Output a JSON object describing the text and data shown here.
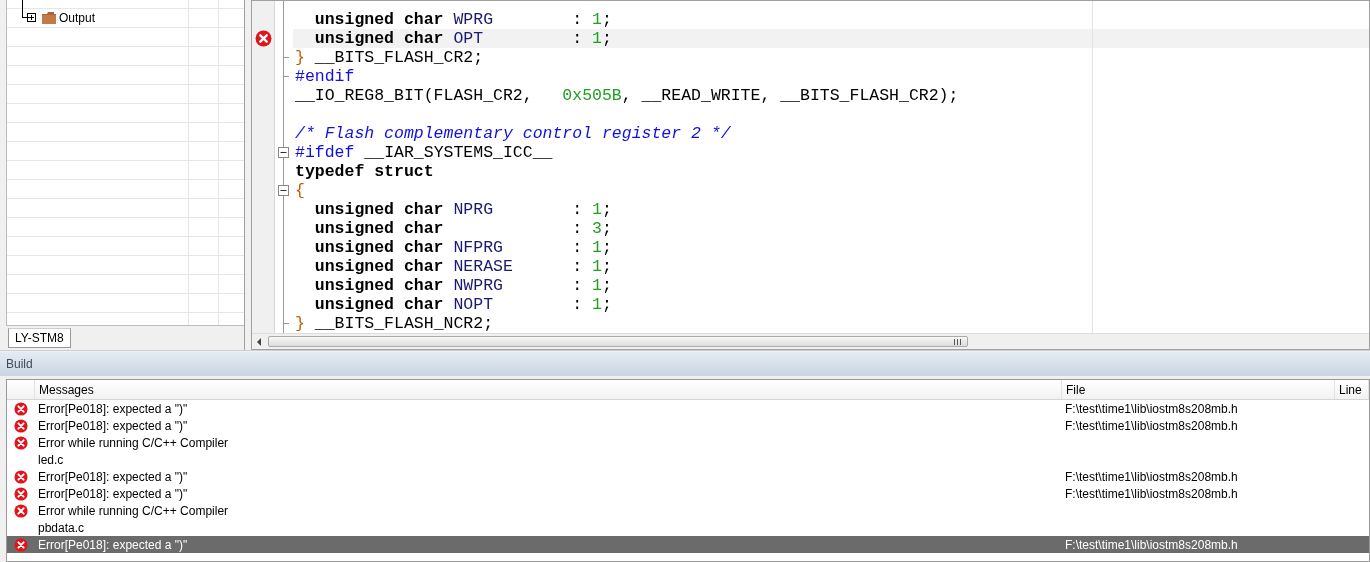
{
  "workspace": {
    "tree": [
      {
        "label": "Output",
        "expanded": false
      }
    ],
    "tabs": [
      {
        "label": "LY-STM8",
        "selected": true
      }
    ]
  },
  "editor": {
    "lines": [
      {
        "kind": "plain",
        "indented": true,
        "error": false,
        "highlighted": false,
        "tokens": [
          {
            "kind": "keyword",
            "text": "unsigned char"
          },
          {
            "kind": "ident",
            "text": " WPRG"
          },
          {
            "kind": "plain",
            "text": "        : "
          },
          {
            "kind": "number",
            "text": "1"
          },
          {
            "kind": "plain",
            "text": ";"
          }
        ]
      },
      {
        "kind": "plain",
        "indented": true,
        "error": true,
        "highlighted": true,
        "tokens": [
          {
            "kind": "keyword",
            "text": "unsigned char"
          },
          {
            "kind": "ident",
            "text": " OPT"
          },
          {
            "kind": "plain",
            "text": "         : "
          },
          {
            "kind": "number",
            "text": "1"
          },
          {
            "kind": "plain",
            "text": ";"
          }
        ]
      },
      {
        "kind": "end",
        "indented": false,
        "error": false,
        "highlighted": false,
        "tokens": [
          {
            "kind": "brace",
            "text": "}"
          },
          {
            "kind": "plain",
            "text": " __BITS_FLASH_CR2;"
          }
        ]
      },
      {
        "kind": "end",
        "indented": false,
        "error": false,
        "highlighted": false,
        "tokens": [
          {
            "kind": "directive",
            "text": "#endif"
          }
        ]
      },
      {
        "kind": "plain",
        "indented": false,
        "error": false,
        "highlighted": false,
        "tokens": [
          {
            "kind": "plain",
            "text": "__IO_REG8_BIT(FLASH_CR2,   "
          },
          {
            "kind": "number",
            "text": "0x505B"
          },
          {
            "kind": "plain",
            "text": ", __READ_WRITE, __BITS_FLASH_CR2);"
          }
        ]
      },
      {
        "kind": "plain"
      },
      {
        "kind": "plain",
        "indented": false,
        "error": false,
        "highlighted": false,
        "tokens": [
          {
            "kind": "comment",
            "text": "/* Flash complementary control register 2 */"
          }
        ]
      },
      {
        "kind": "collapse",
        "indented": false,
        "error": false,
        "highlighted": false,
        "tokens": [
          {
            "kind": "directive",
            "text": "#ifdef"
          },
          {
            "kind": "plain",
            "text": " __IAR_SYSTEMS_ICC__"
          }
        ]
      },
      {
        "kind": "plain",
        "indented": false,
        "error": false,
        "highlighted": false,
        "tokens": [
          {
            "kind": "keyword",
            "text": "typedef struct"
          }
        ]
      },
      {
        "kind": "collapse",
        "indented": false,
        "error": false,
        "highlighted": false,
        "tokens": [
          {
            "kind": "brace",
            "text": "{"
          }
        ]
      },
      {
        "kind": "plain",
        "indented": true,
        "error": false,
        "highlighted": false,
        "tokens": [
          {
            "kind": "keyword",
            "text": "unsigned char"
          },
          {
            "kind": "ident",
            "text": " NPRG"
          },
          {
            "kind": "plain",
            "text": "        : "
          },
          {
            "kind": "number",
            "text": "1"
          },
          {
            "kind": "plain",
            "text": ";"
          }
        ]
      },
      {
        "kind": "plain",
        "indented": true,
        "error": false,
        "highlighted": false,
        "tokens": [
          {
            "kind": "keyword",
            "text": "unsigned char"
          },
          {
            "kind": "plain",
            "text": "             : "
          },
          {
            "kind": "number",
            "text": "3"
          },
          {
            "kind": "plain",
            "text": ";"
          }
        ]
      },
      {
        "kind": "plain",
        "indented": true,
        "error": false,
        "highlighted": false,
        "tokens": [
          {
            "kind": "keyword",
            "text": "unsigned char"
          },
          {
            "kind": "ident",
            "text": " NFPRG"
          },
          {
            "kind": "plain",
            "text": "       : "
          },
          {
            "kind": "number",
            "text": "1"
          },
          {
            "kind": "plain",
            "text": ";"
          }
        ]
      },
      {
        "kind": "plain",
        "indented": true,
        "error": false,
        "highlighted": false,
        "tokens": [
          {
            "kind": "keyword",
            "text": "unsigned char"
          },
          {
            "kind": "ident",
            "text": " NERASE"
          },
          {
            "kind": "plain",
            "text": "      : "
          },
          {
            "kind": "number",
            "text": "1"
          },
          {
            "kind": "plain",
            "text": ";"
          }
        ]
      },
      {
        "kind": "plain",
        "indented": true,
        "error": false,
        "highlighted": false,
        "tokens": [
          {
            "kind": "keyword",
            "text": "unsigned char"
          },
          {
            "kind": "ident",
            "text": " NWPRG"
          },
          {
            "kind": "plain",
            "text": "       : "
          },
          {
            "kind": "number",
            "text": "1"
          },
          {
            "kind": "plain",
            "text": ";"
          }
        ]
      },
      {
        "kind": "plain",
        "indented": true,
        "error": false,
        "highlighted": false,
        "tokens": [
          {
            "kind": "keyword",
            "text": "unsigned char"
          },
          {
            "kind": "ident",
            "text": " NOPT"
          },
          {
            "kind": "plain",
            "text": "        : "
          },
          {
            "kind": "number",
            "text": "1"
          },
          {
            "kind": "plain",
            "text": ";"
          }
        ]
      },
      {
        "kind": "end",
        "indented": false,
        "error": false,
        "highlighted": false,
        "tokens": [
          {
            "kind": "brace",
            "text": "}"
          },
          {
            "kind": "plain",
            "text": " __BITS_FLASH_NCR2;"
          }
        ]
      }
    ]
  },
  "build": {
    "title": "Build",
    "columns": [
      "Messages",
      "File",
      "Line"
    ],
    "rows": [
      {
        "kind": "error",
        "message": "Error[Pe018]: expected a \")\"",
        "file": "F:\\test\\time1\\lib\\iostm8s208mb.h",
        "selected": false
      },
      {
        "kind": "error",
        "message": "Error[Pe018]: expected a \")\"",
        "file": "F:\\test\\time1\\lib\\iostm8s208mb.h",
        "selected": false
      },
      {
        "kind": "error",
        "message": "Error while running C/C++ Compiler",
        "selected": false
      },
      {
        "kind": "plain",
        "message": "led.c",
        "selected": false
      },
      {
        "kind": "error",
        "message": "Error[Pe018]: expected a \")\"",
        "file": "F:\\test\\time1\\lib\\iostm8s208mb.h",
        "selected": false
      },
      {
        "kind": "error",
        "message": "Error[Pe018]: expected a \")\"",
        "file": "F:\\test\\time1\\lib\\iostm8s208mb.h",
        "selected": false
      },
      {
        "kind": "error",
        "message": "Error while running C/C++ Compiler",
        "selected": false
      },
      {
        "kind": "plain",
        "message": "pbdata.c",
        "selected": false
      },
      {
        "kind": "error",
        "message": "Error[Pe018]: expected a \")\"",
        "file": "F:\\test\\time1\\lib\\iostm8s208mb.h",
        "selected": true
      }
    ]
  }
}
